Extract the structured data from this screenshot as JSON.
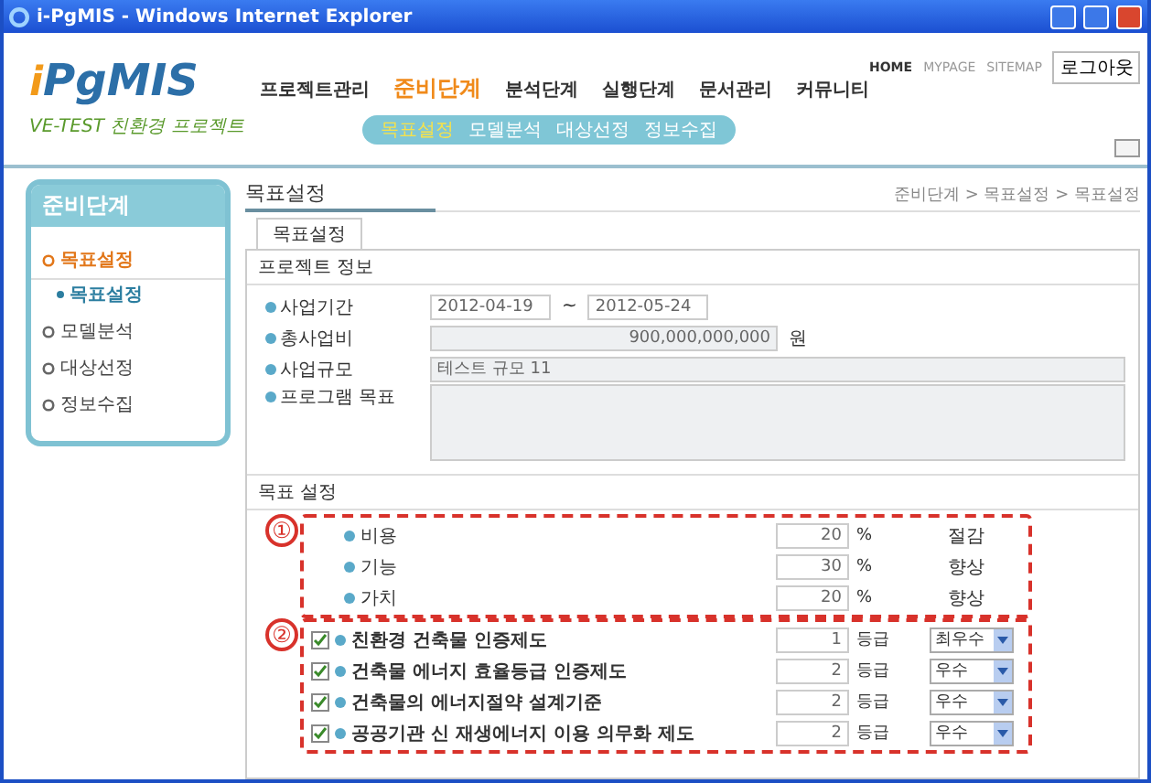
{
  "window": {
    "title": "i-PgMIS - Windows Internet Explorer"
  },
  "header": {
    "logo": "PgMIS",
    "logo_prefix": "i",
    "subtitle": "VE-TEST 친환경 프로젝트",
    "top_links": [
      "HOME",
      "MYPAGE",
      "SITEMAP"
    ],
    "logout": "로그아웃",
    "nav": [
      {
        "label": "프로젝트관리",
        "selected": false
      },
      {
        "label": "준비단계",
        "selected": true
      },
      {
        "label": "분석단계",
        "selected": false
      },
      {
        "label": "실행단계",
        "selected": false
      },
      {
        "label": "문서관리",
        "selected": false
      },
      {
        "label": "커뮤니티",
        "selected": false
      }
    ],
    "subnav": [
      {
        "label": "목표설정",
        "selected": true
      },
      {
        "label": "모델분석",
        "selected": false
      },
      {
        "label": "대상선정",
        "selected": false
      },
      {
        "label": "정보수집",
        "selected": false
      }
    ]
  },
  "sidebar": {
    "title": "준비단계",
    "items": [
      {
        "label": "목표설정",
        "selected": true,
        "children": [
          {
            "label": "목표설정",
            "selected": true
          }
        ]
      },
      {
        "label": "모델분석",
        "selected": false
      },
      {
        "label": "대상선정",
        "selected": false
      },
      {
        "label": "정보수집",
        "selected": false
      }
    ]
  },
  "page": {
    "title": "목표설정",
    "breadcrumb": "준비단계 > 목표설정 > 목표설정",
    "tabs": [
      {
        "label": "목표설정",
        "selected": true
      }
    ]
  },
  "project_info": {
    "heading": "프로젝트 정보",
    "period": {
      "label": "사업기간",
      "start": "2012-04-19",
      "separator": "~",
      "end": "2012-05-24"
    },
    "budget": {
      "label": "총사업비",
      "value": "900,000,000,000",
      "unit": "원"
    },
    "scale": {
      "label": "사업규모",
      "value": "테스트 규모 11"
    },
    "program_goal": {
      "label": "프로그램 목표"
    }
  },
  "goal_setting": {
    "heading": "목표 설정",
    "groups": [
      {
        "marker": "①",
        "rows": [
          {
            "label": "비용",
            "value": "20",
            "unit": "%",
            "result": "절감"
          },
          {
            "label": "기능",
            "value": "30",
            "unit": "%",
            "result": "향상"
          },
          {
            "label": "가치",
            "value": "20",
            "unit": "%",
            "result": "향상"
          }
        ]
      },
      {
        "marker": "②",
        "rows": [
          {
            "label": "친환경 건축물 인증제도",
            "checked": true,
            "value": "1",
            "unit": "등급",
            "grade": "최우수"
          },
          {
            "label": "건축물 에너지 효율등급 인증제도",
            "checked": true,
            "value": "2",
            "unit": "등급",
            "grade": "우수"
          },
          {
            "label": "건축물의 에너지절약 설계기준",
            "checked": true,
            "value": "2",
            "unit": "등급",
            "grade": "우수"
          },
          {
            "label": "공공기관 신 재생에너지 이용 의무화 제도",
            "checked": true,
            "value": "2",
            "unit": "등급",
            "grade": "우수"
          }
        ]
      }
    ]
  }
}
